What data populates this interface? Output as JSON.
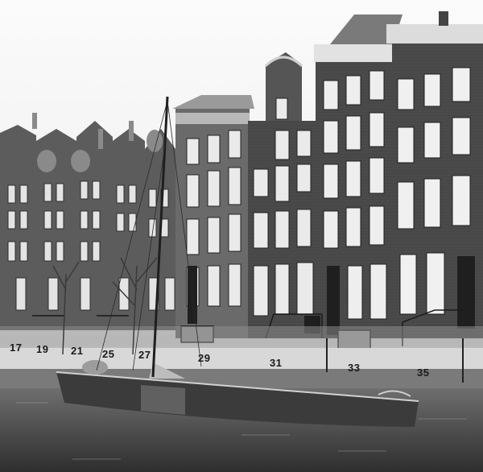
{
  "house_numbers": [
    "17",
    "19",
    "21",
    "25",
    "27",
    "29",
    "31",
    "33",
    "35"
  ]
}
